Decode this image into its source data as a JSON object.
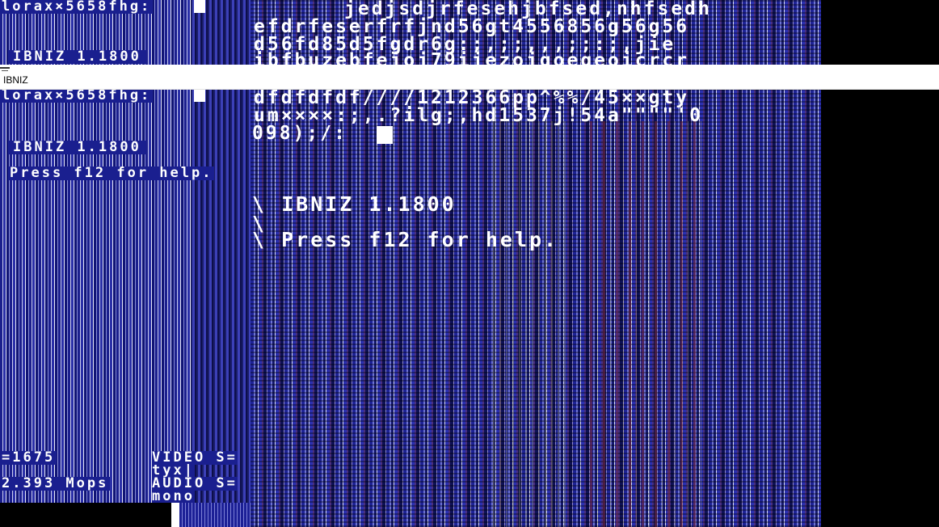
{
  "window": {
    "title": "IBNIZ"
  },
  "left_panel": {
    "top_code": "lorax×5658fhg:",
    "version_top": "IBNIZ 1.1800",
    "code_line_2": "lorax×5658fhg:",
    "version": "IBNIZ 1.1800",
    "help": "Press f12 for help.",
    "frame_count": "=1675",
    "mops": "2.393 Mops",
    "video_label": "VIDEO S=",
    "video_mode": "tyx|",
    "audio_label": "AUDIO S=",
    "audio_mode": "mono"
  },
  "main_editor": {
    "lines": [
      "jedjsdjrfesehjbfsed,nhfsedh",
      "efdrfeserfrfjnd56gt4556856g56g56",
      "d56fd85d5fgdr6g:;,;;,,,;;:;,jie",
      "ibfbuzebfejoj79ijezojgoegeoicrcr",
      "dfdfdfdf////1212366pp^%%/45××gty",
      "um××××:;,.?ilg;,hd1537j!54a\"\"\"\"'0",
      "098);/:"
    ],
    "banner_version": "\\ IBNIZ 1.1800",
    "banner_blank": "\\",
    "banner_help": "\\ Press f12 for help."
  },
  "colors": {
    "stripe_blue": "#1e2396",
    "stripe_light": "#d9dbf6",
    "text": "#ffffff",
    "titlebar": "#ffffff"
  }
}
